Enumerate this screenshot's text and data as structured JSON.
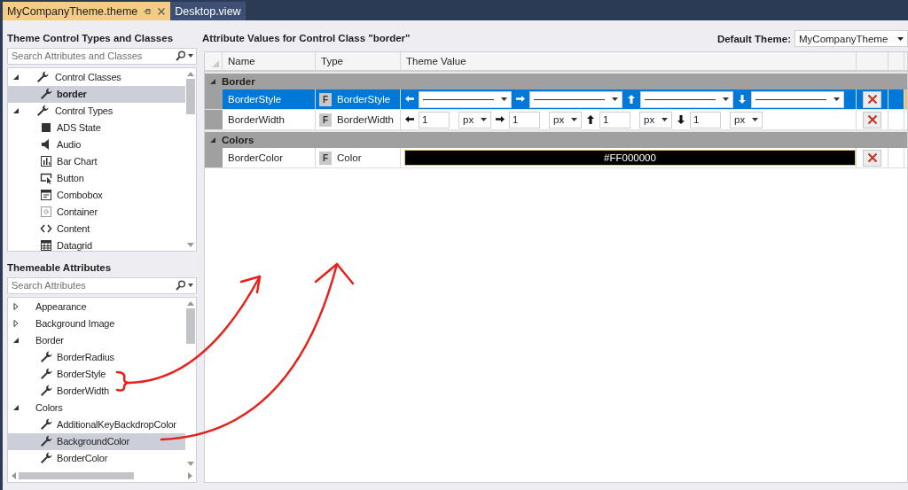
{
  "tabs": [
    {
      "label": "MyCompanyTheme.theme",
      "selected": true
    },
    {
      "label": "Desktop.view",
      "selected": false
    }
  ],
  "types_panel": {
    "title": "Theme Control Types and Classes",
    "search": {
      "placeholder": "Search Attributes and Classes"
    },
    "tree": [
      {
        "label": "Control Classes",
        "expanded": true,
        "kind": "class",
        "children": [
          {
            "label": "border",
            "kind": "class",
            "selected": true
          }
        ]
      },
      {
        "label": "Control Types",
        "expanded": true,
        "kind": "class",
        "children": [
          {
            "label": "ADS State",
            "kind": "state",
            "selected": false
          },
          {
            "label": "Audio",
            "kind": "audio",
            "selected": false
          },
          {
            "label": "Bar Chart",
            "kind": "chart",
            "selected": false
          },
          {
            "label": "Button",
            "kind": "button",
            "selected": false
          },
          {
            "label": "Combobox",
            "kind": "combobox",
            "selected": false
          },
          {
            "label": "Container",
            "kind": "container",
            "selected": false
          },
          {
            "label": "Content",
            "kind": "content",
            "selected": false
          },
          {
            "label": "Datagrid",
            "kind": "datagrid",
            "selected": false
          }
        ]
      }
    ]
  },
  "attributes_panel": {
    "title": "Themeable Attributes",
    "search": {
      "placeholder": "Search Attributes"
    },
    "tree": [
      {
        "label": "Appearance",
        "expanded": false
      },
      {
        "label": "Background Image",
        "expanded": false
      },
      {
        "label": "Border",
        "expanded": true,
        "children": [
          {
            "label": "BorderRadius",
            "selected": false
          },
          {
            "label": "BorderStyle",
            "selected": false
          },
          {
            "label": "BorderWidth",
            "selected": false
          }
        ]
      },
      {
        "label": "Colors",
        "expanded": true,
        "children": [
          {
            "label": "AdditionalKeyBackdropColor",
            "selected": false
          },
          {
            "label": "BackgroundColor",
            "selected": true
          },
          {
            "label": "BorderColor",
            "selected": false
          }
        ]
      }
    ]
  },
  "values_panel": {
    "title": "Attribute Values for Control Class \"border\"",
    "default_theme": {
      "label": "Default Theme:",
      "value": "MyCompanyTheme"
    },
    "columns": [
      "Name",
      "Type",
      "Theme Value"
    ],
    "groups": [
      {
        "label": "Border",
        "expanded": true,
        "rows": [
          {
            "name": "BorderStyle",
            "badge": "F",
            "type": "BorderStyle",
            "kind": "border_style",
            "selected": true
          },
          {
            "name": "BorderWidth",
            "badge": "F",
            "type": "BorderWidth",
            "kind": "border_width",
            "selected": false,
            "sides": [
              {
                "value": "1",
                "unit": "px"
              },
              {
                "value": "1",
                "unit": "px"
              },
              {
                "value": "1",
                "unit": "px"
              },
              {
                "value": "1",
                "unit": "px"
              }
            ]
          }
        ]
      },
      {
        "label": "Colors",
        "expanded": true,
        "rows": [
          {
            "name": "BorderColor",
            "badge": "F",
            "type": "Color",
            "kind": "color",
            "selected": false,
            "value": "#FF000000",
            "color": "#000000"
          }
        ]
      }
    ]
  }
}
